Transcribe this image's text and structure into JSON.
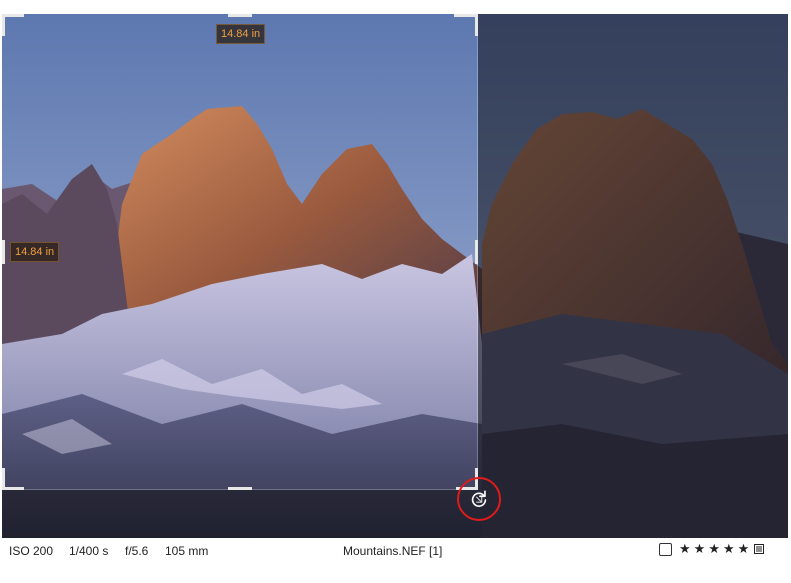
{
  "image": {
    "filename": "Mountains.NEF [1]",
    "subject": "mountain peaks at sunset"
  },
  "crop": {
    "width_label": "14.84 in",
    "height_label": "14.84 in"
  },
  "status": {
    "iso": "ISO 200",
    "shutter": "1/400 s",
    "aperture": "f/5.6",
    "focal": "105 mm"
  },
  "rating": {
    "stars": [
      "★",
      "★",
      "★",
      "★",
      "★"
    ]
  },
  "colors": {
    "crop_label_text": "#f0a040",
    "highlight_ring": "#e01b1b"
  },
  "icons": {
    "rotate": "rotate-icon",
    "list": "list-icon",
    "checkbox": "checkbox-icon"
  }
}
